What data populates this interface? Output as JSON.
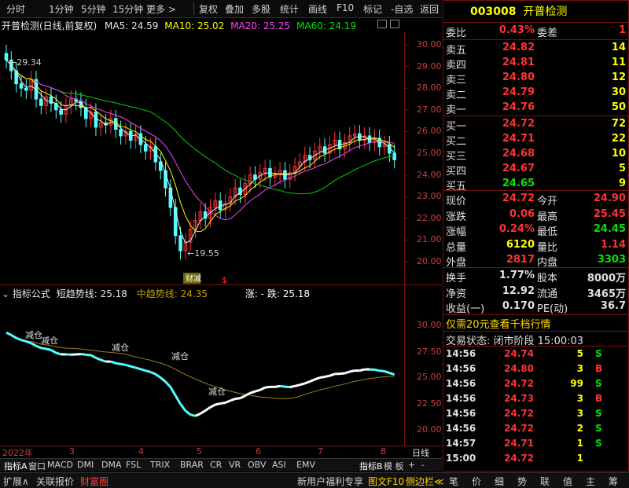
{
  "toolbar": {
    "items": [
      "分时",
      "1分钟",
      "5分钟",
      "15分钟",
      "更多 >",
      "复权",
      "叠加",
      "多股",
      "统计",
      "画线",
      "F10",
      "标记",
      "-自选",
      "返回"
    ]
  },
  "stock": {
    "code": "003008",
    "name": "开普检测"
  },
  "chart": {
    "title": "开普检测(日线,前复权)",
    "ma5": "MA5: 24.59",
    "ma10": "MA10: 25.02",
    "ma20": "MA20: 25.25",
    "ma60": "MA60: 24.19",
    "high_label": "29.34",
    "low_label": "19.55",
    "reduce_label": "减",
    "s_label": "$",
    "yticks": [
      "30.00",
      "29.00",
      "28.00",
      "27.00",
      "26.00",
      "25.00",
      "24.00",
      "23.00",
      "22.00",
      "21.00",
      "20.00"
    ]
  },
  "indicator": {
    "formula": "指标公式",
    "short": "短趋势线: 25.18",
    "mid": "中趋势线: 24.35",
    "updown": "涨: -  跌: 25.18",
    "yticks": [
      "30.00",
      "27.50",
      "25.00",
      "22.50",
      "20.00"
    ],
    "labels": [
      "减仓",
      "减仓",
      "减仓",
      "减仓",
      "减仓"
    ]
  },
  "xaxis": {
    "labels": [
      "2022年",
      "3",
      "4",
      "5",
      "6",
      "7",
      "8"
    ],
    "period": "日线"
  },
  "indicator_tabs": [
    "指标A",
    "窗口",
    "MACD",
    "DMI",
    "DMA",
    "FSL",
    "TRIX",
    "BRAR",
    "CR",
    "VR",
    "OBV",
    "ASI",
    "EMV",
    "指标B",
    "模 板",
    "+",
    "-"
  ],
  "bottom_left": [
    "扩展∧",
    "关联报价",
    "财富圈"
  ],
  "bottom_mid": [
    "新用户福利专享",
    "图文F10",
    "侧边栏≪"
  ],
  "bottom_right": [
    "笔",
    "价",
    "细",
    "势",
    "联",
    "值",
    "主",
    "筹"
  ],
  "quote": {
    "webi_label": "委比",
    "webi_val": "0.43%",
    "weicha_label": "委差",
    "weicha_val": "1",
    "sells": [
      {
        "label": "卖五",
        "price": "24.82",
        "vol": "14"
      },
      {
        "label": "卖四",
        "price": "24.81",
        "vol": "11"
      },
      {
        "label": "卖三",
        "price": "24.80",
        "vol": "12"
      },
      {
        "label": "卖二",
        "price": "24.79",
        "vol": "30"
      },
      {
        "label": "卖一",
        "price": "24.76",
        "vol": "50"
      }
    ],
    "buys": [
      {
        "label": "买一",
        "price": "24.72",
        "vol": "72"
      },
      {
        "label": "买二",
        "price": "24.71",
        "vol": "22"
      },
      {
        "label": "买三",
        "price": "24.68",
        "vol": "10"
      },
      {
        "label": "买四",
        "price": "24.67",
        "vol": "5"
      },
      {
        "label": "买五",
        "price": "24.65",
        "vol": "9"
      }
    ],
    "stats": [
      {
        "l1": "现价",
        "v1": "24.72",
        "l2": "今开",
        "v2": "24.90"
      },
      {
        "l1": "涨跌",
        "v1": "0.06",
        "l2": "最高",
        "v2": "25.45"
      },
      {
        "l1": "涨幅",
        "v1": "0.24%",
        "l2": "最低",
        "v2": "24.45"
      },
      {
        "l1": "总量",
        "v1": "6120",
        "l2": "量比",
        "v2": "1.14"
      },
      {
        "l1": "外盘",
        "v1": "2817",
        "l2": "内盘",
        "v2": "3303"
      }
    ],
    "stats2": [
      {
        "l1": "换手",
        "v1": "1.77%",
        "l2": "股本",
        "v2": "8000万"
      },
      {
        "l1": "净资",
        "v1": "12.92",
        "l2": "流通",
        "v2": "3465万"
      },
      {
        "l1": "收益(一)",
        "v1": "0.170",
        "l2": "PE(动)",
        "v2": "36.7"
      }
    ],
    "promo": "仅需20元查看千档行情",
    "status": "交易状态: 闭市阶段  15:00:03"
  },
  "ticks": [
    {
      "t": "14:56",
      "p": "24.74",
      "v": "5",
      "d": "S"
    },
    {
      "t": "14:56",
      "p": "24.80",
      "v": "3",
      "d": "B"
    },
    {
      "t": "14:56",
      "p": "24.72",
      "v": "99",
      "d": "S"
    },
    {
      "t": "14:56",
      "p": "24.73",
      "v": "3",
      "d": "B"
    },
    {
      "t": "14:56",
      "p": "24.72",
      "v": "3",
      "d": "S"
    },
    {
      "t": "14:56",
      "p": "24.72",
      "v": "2",
      "d": "S"
    },
    {
      "t": "14:57",
      "p": "24.71",
      "v": "1",
      "d": "S"
    },
    {
      "t": "15:00",
      "p": "24.72",
      "v": "1",
      "d": ""
    }
  ]
}
